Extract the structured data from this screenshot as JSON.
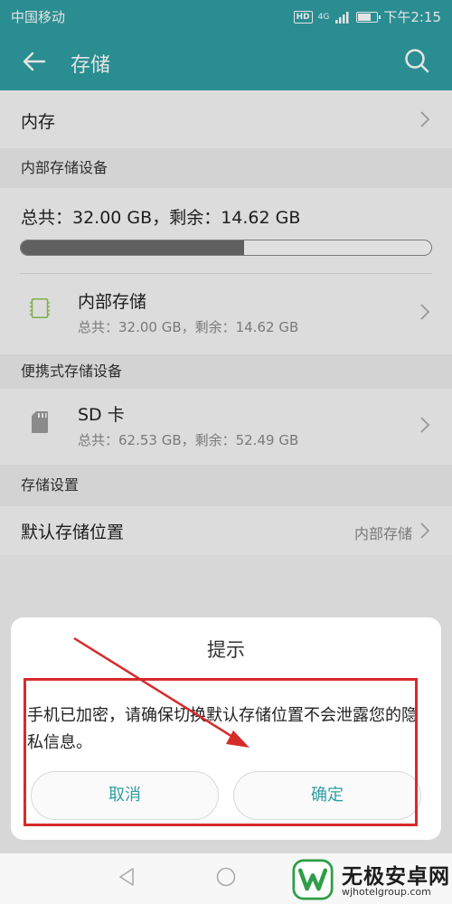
{
  "status_bar": {
    "carrier": "中国移动",
    "time": "下午2:15",
    "hd": "HD",
    "net": "4G"
  },
  "app_bar": {
    "title": "存储"
  },
  "memory_row": {
    "label": "内存"
  },
  "internal_section": {
    "header": "内部存储设备",
    "summary": "总共：32.00 GB，剩余：14.62 GB",
    "used_fraction": 0.543,
    "item": {
      "title": "内部存储",
      "detail": "总共：32.00 GB，剩余：14.62 GB"
    }
  },
  "portable_section": {
    "header": "便携式存储设备",
    "item": {
      "title": "SD 卡",
      "detail": "总共：62.53 GB，剩余：52.49 GB"
    }
  },
  "settings_section": {
    "header": "存储设置",
    "default_location": {
      "label": "默认存储位置",
      "value": "内部存储"
    }
  },
  "dialog": {
    "title": "提示",
    "message": "手机已加密，请确保切换默认存储位置不会泄露您的隐私信息。",
    "cancel_label": "取消",
    "ok_label": "确定"
  },
  "watermark": {
    "name": "无极安卓网",
    "url": "wjhotelgroup.com"
  },
  "colors": {
    "accent": "#2f9ea2",
    "annotation": "#d62b2b"
  }
}
